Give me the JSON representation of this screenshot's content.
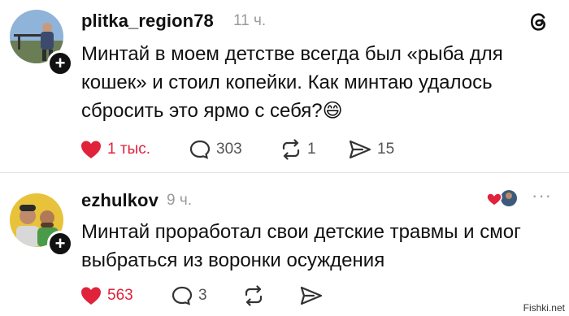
{
  "comments": [
    {
      "username": "plitka_region78",
      "time": "11 ч.",
      "text_line1": "Минтай в моем детстве всегда был «рыба для",
      "text_line2": "кошек» и стоил копейки. Как минтаю удалось",
      "text_line3": "сбросить это ярмо с себя?",
      "emoji": "😄",
      "likes": "1 тыс.",
      "replies": "303",
      "reposts": "1",
      "shares": "15",
      "liked": true
    },
    {
      "username": "ezhulkov",
      "time": "9 ч.",
      "text_line1": "Минтай проработал свои детские травмы и смог",
      "text_line2": "выбраться из воронки осуждения",
      "likes": "563",
      "replies": "3",
      "liked": true
    }
  ],
  "icons": {
    "app_logo": "threads-logo-icon",
    "like": "heart-icon",
    "reply": "comment-bubble-icon",
    "repost": "repost-icon",
    "share": "send-icon",
    "more": "more-dots-icon"
  },
  "colors": {
    "like_red": "#e0223a",
    "muted_gray": "#9a9a9a"
  },
  "watermark": "Fishki.net"
}
